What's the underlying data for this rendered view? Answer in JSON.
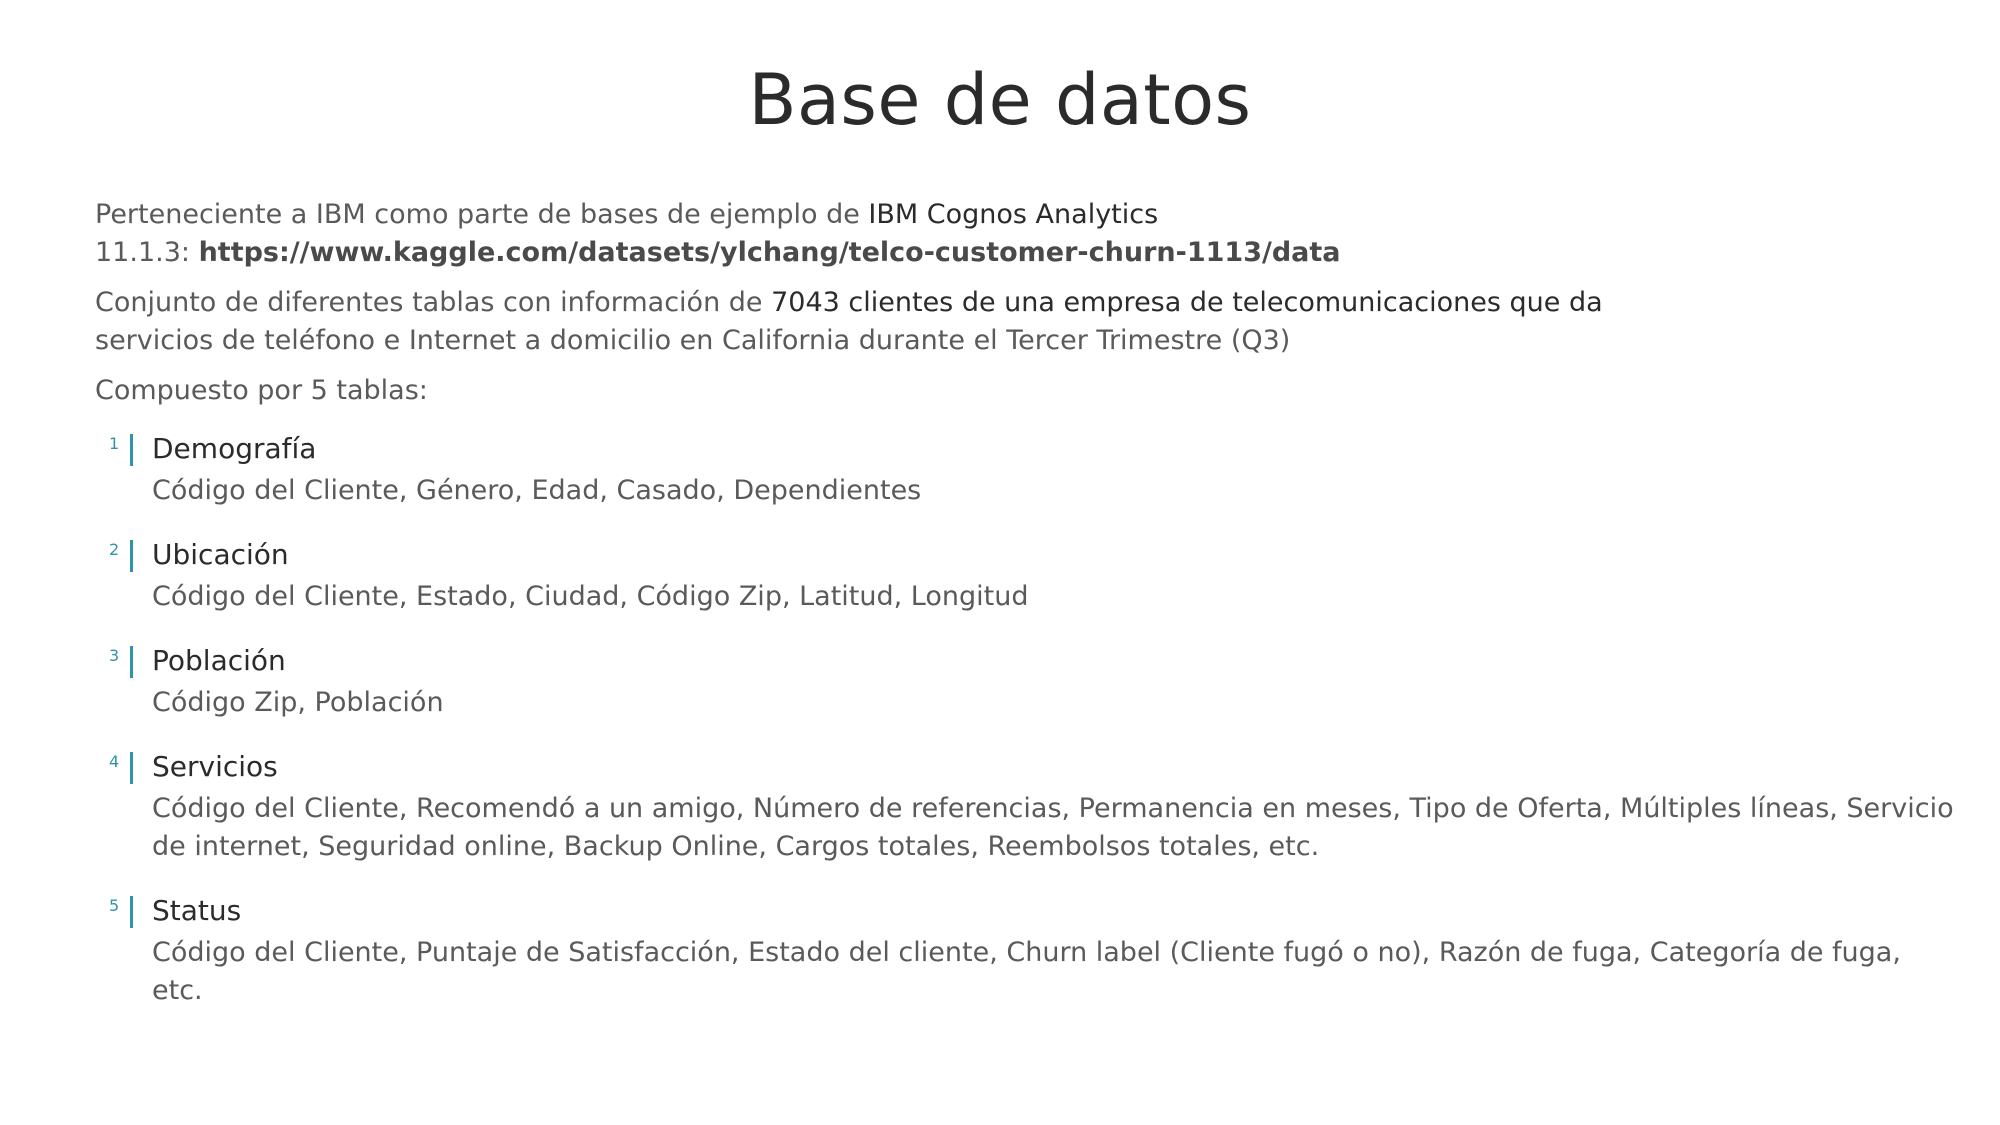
{
  "title": "Base de datos",
  "intro": {
    "line1_prefix": "Perteneciente a IBM como parte de bases de ejemplo de ",
    "line1_highlight": "IBM Cognos Analytics",
    "line2_prefix": "11.1.3: ",
    "link": "https://www.kaggle.com/datasets/ylchang/telco-customer-churn-1113/data"
  },
  "description": {
    "prefix": "Conjunto de diferentes tablas con información de ",
    "highlight": "7043 clientes de una empresa de telecomunicaciones que da",
    "rest": "servicios de teléfono e Internet a domicilio en California durante el Tercer Trimestre (Q3)"
  },
  "composed": "Compuesto por 5 tablas:",
  "tables": [
    {
      "num": "1",
      "name": "Demografía",
      "fields": "Código del Cliente, Género, Edad, Casado, Dependientes"
    },
    {
      "num": "2",
      "name": "Ubicación",
      "fields": "Código del Cliente, Estado, Ciudad, Código Zip, Latitud, Longitud"
    },
    {
      "num": "3",
      "name": "Población",
      "fields": "Código Zip, Población"
    },
    {
      "num": "4",
      "name": "Servicios",
      "fields": "Código del Cliente, Recomendó a un amigo, Número de referencias, Permanencia en meses, Tipo de Oferta, Múltiples líneas, Servicio de internet, Seguridad online, Backup Online, Cargos totales, Reembolsos totales, etc."
    },
    {
      "num": "5",
      "name": "Status",
      "fields": "Código del Cliente, Puntaje de Satisfacción, Estado del cliente, Churn label (Cliente fugó o no), Razón de fuga, Categoría de fuga, etc."
    }
  ],
  "colors": {
    "accent": "#2e94a6",
    "title": "#2b2b2b",
    "body": "#5a5a5a"
  }
}
